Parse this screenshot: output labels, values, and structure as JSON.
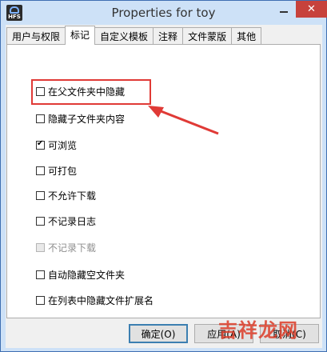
{
  "window": {
    "title": "Properties for toy",
    "app_icon_label": "HFS",
    "close_symbol": "✕"
  },
  "tabs": [
    {
      "label": "用户与权限",
      "active": false
    },
    {
      "label": "标记",
      "active": true
    },
    {
      "label": "自定义模板",
      "active": false
    },
    {
      "label": "注释",
      "active": false
    },
    {
      "label": "文件蒙版",
      "active": false
    },
    {
      "label": "其他",
      "active": false
    }
  ],
  "options": [
    {
      "label": "在父文件夹中隐藏",
      "checked": false,
      "enabled": true
    },
    {
      "label": "隐藏子文件夹内容",
      "checked": false,
      "enabled": true
    },
    {
      "label": "可浏览",
      "checked": true,
      "enabled": true
    },
    {
      "label": "可打包",
      "checked": false,
      "enabled": true
    },
    {
      "label": "不允许下载",
      "checked": false,
      "enabled": true
    },
    {
      "label": "不记录日志",
      "checked": false,
      "enabled": true
    },
    {
      "label": "不记录下载",
      "checked": false,
      "enabled": false
    },
    {
      "label": "自动隐藏空文件夹",
      "checked": false,
      "enabled": true
    },
    {
      "label": "在列表中隐藏文件扩展名",
      "checked": false,
      "enabled": true
    }
  ],
  "buttons": {
    "ok": "确定(O)",
    "apply": "应用(A)",
    "cancel": "取消(C)"
  },
  "annotation": {
    "highlight_color": "#e03a36"
  },
  "watermark": "吉祥龙网"
}
